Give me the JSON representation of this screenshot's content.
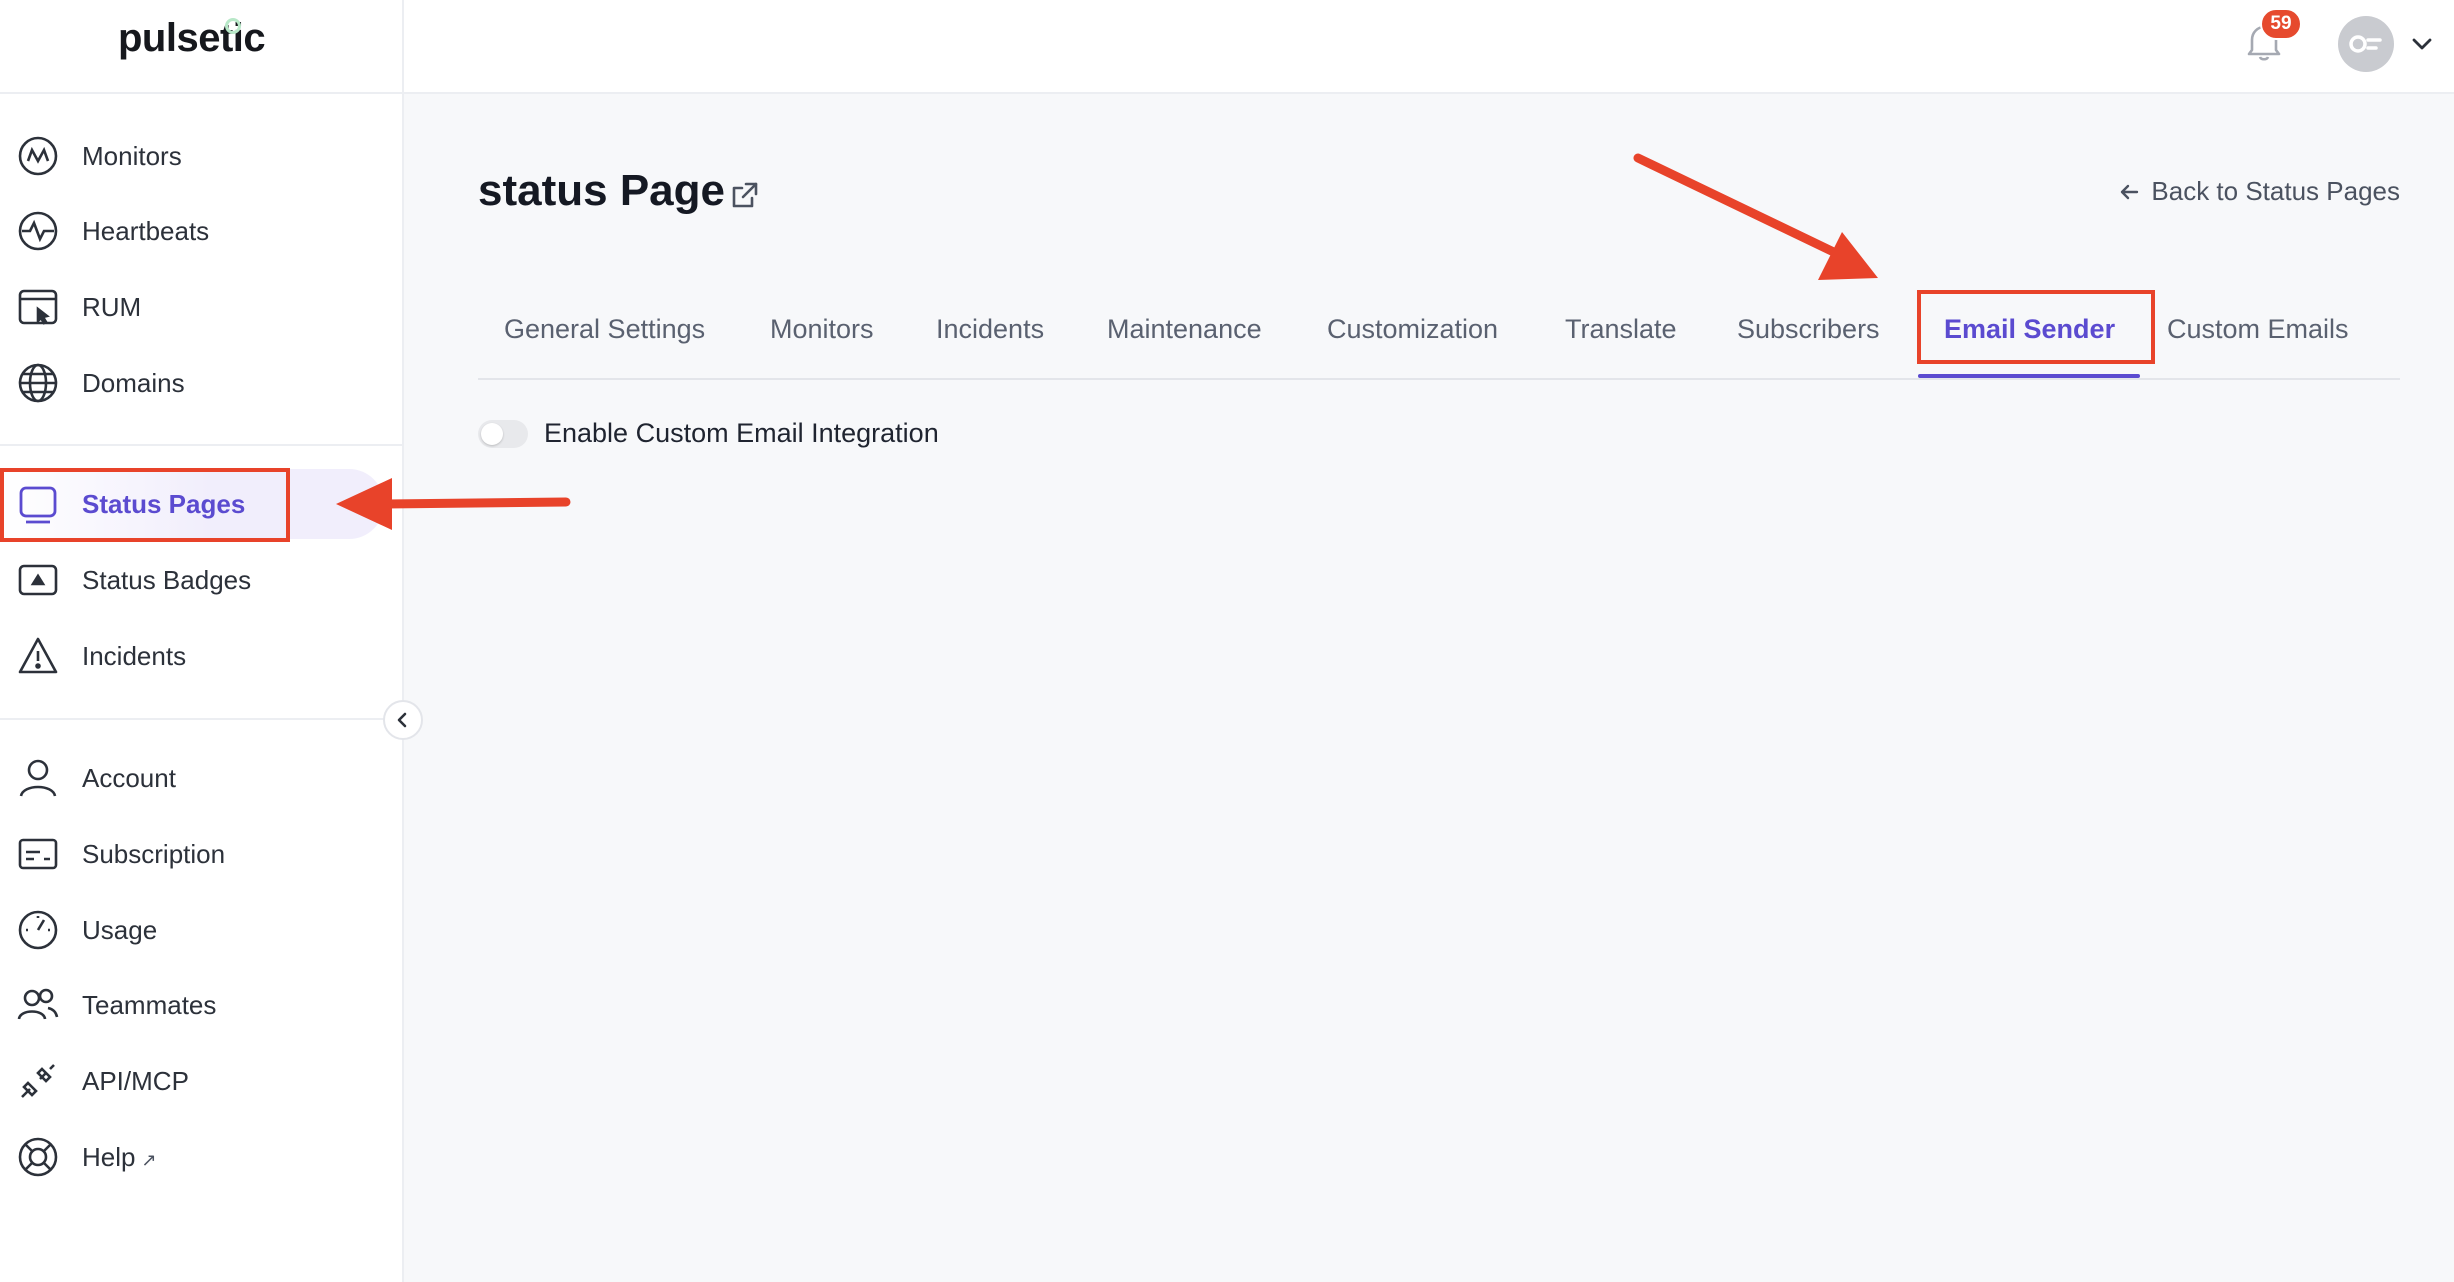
{
  "brand": {
    "name": "pulsetic"
  },
  "sidebar": {
    "groups": [
      [
        {
          "label": "Monitors",
          "icon": "monitor-wave-icon"
        },
        {
          "label": "Heartbeats",
          "icon": "heartbeat-icon"
        },
        {
          "label": "RUM",
          "icon": "rum-window-icon"
        },
        {
          "label": "Domains",
          "icon": "globe-icon"
        }
      ],
      [
        {
          "label": "Status Pages",
          "icon": "status-page-icon",
          "active": true
        },
        {
          "label": "Status Badges",
          "icon": "status-badge-icon"
        },
        {
          "label": "Incidents",
          "icon": "warning-triangle-icon"
        }
      ],
      [
        {
          "label": "Account",
          "icon": "user-icon"
        },
        {
          "label": "Subscription",
          "icon": "subscription-card-icon"
        },
        {
          "label": "Usage",
          "icon": "gauge-icon"
        },
        {
          "label": "Teammates",
          "icon": "users-icon"
        },
        {
          "label": "API/MCP",
          "icon": "plug-icon"
        },
        {
          "label": "Help",
          "icon": "lifebuoy-icon",
          "external": true
        }
      ]
    ]
  },
  "topbar": {
    "notification_count": "59"
  },
  "main": {
    "title": "status Page",
    "back_link": "Back to Status Pages",
    "tabs": [
      {
        "label": "General Settings"
      },
      {
        "label": "Monitors"
      },
      {
        "label": "Incidents"
      },
      {
        "label": "Maintenance"
      },
      {
        "label": "Customization"
      },
      {
        "label": "Translate"
      },
      {
        "label": "Subscribers"
      },
      {
        "label": "Email Sender",
        "active": true
      },
      {
        "label": "Custom Emails"
      }
    ],
    "toggle": {
      "label": "Enable Custom Email Integration",
      "enabled": false
    }
  },
  "colors": {
    "accent": "#5b4bd0",
    "annotation": "#e8432a",
    "badge": "#e64a2e"
  }
}
